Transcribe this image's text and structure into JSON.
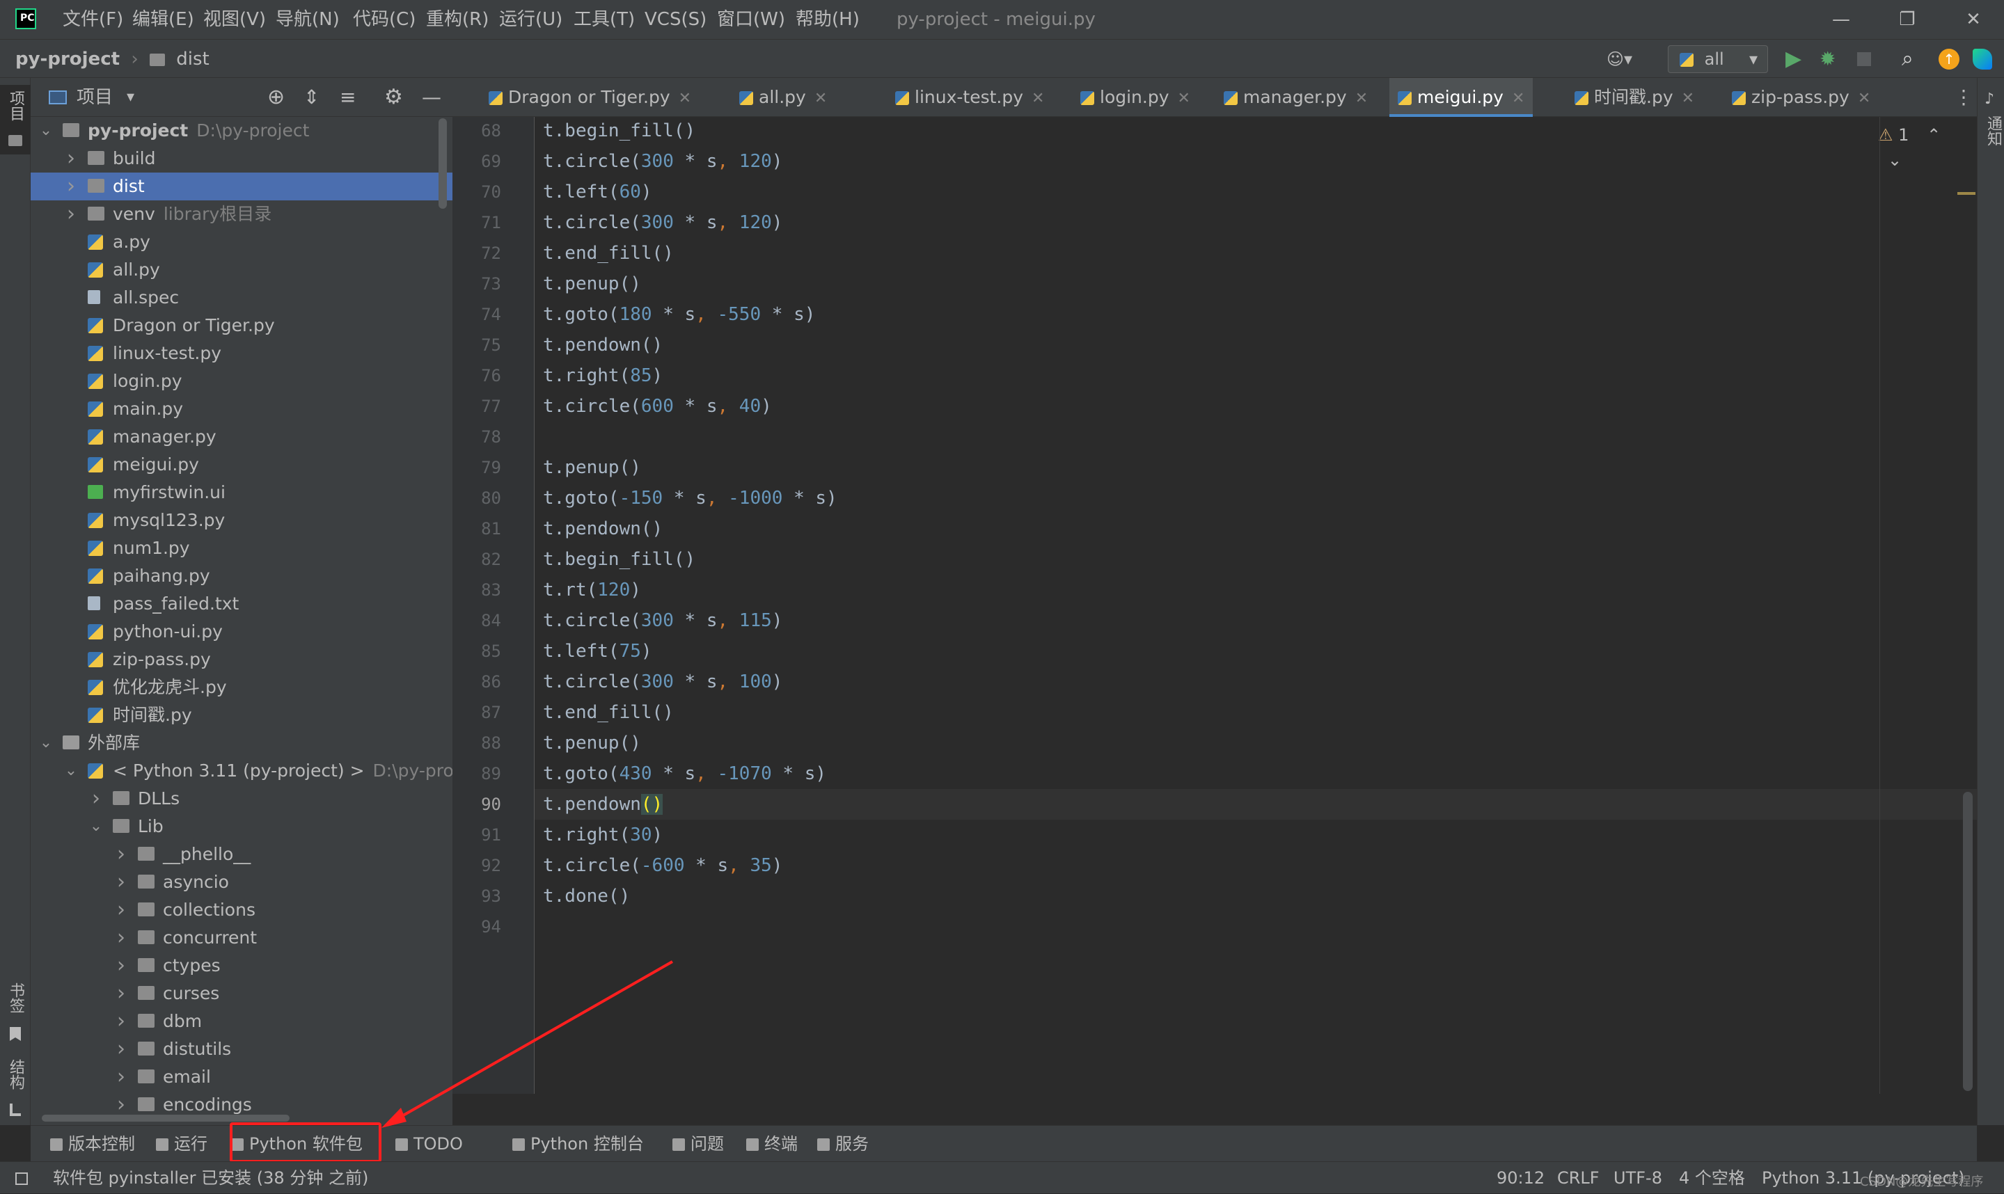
{
  "window": {
    "title": "py-project - meigui.py",
    "menus": [
      "文件(F)",
      "编辑(E)",
      "视图(V)",
      "导航(N)",
      "代码(C)",
      "重构(R)",
      "运行(U)",
      "工具(T)",
      "VCS(S)",
      "窗口(W)",
      "帮助(H)"
    ]
  },
  "navbar": {
    "project": "py-project",
    "folder": "dist",
    "run_config": "all"
  },
  "left_strip": {
    "project_label": "项目",
    "bookmarks_label": "书签",
    "structure_label": "结构"
  },
  "right_strip": {
    "notifications_label": "通知"
  },
  "project_panel": {
    "title": "项目",
    "tree": [
      {
        "label": "py-project",
        "hint": "D:\\py-project",
        "depth": 0,
        "kind": "folder",
        "expanded": true,
        "bold": true
      },
      {
        "label": "build",
        "hint": "",
        "depth": 1,
        "kind": "folder",
        "expanded": false
      },
      {
        "label": "dist",
        "hint": "",
        "depth": 1,
        "kind": "folder",
        "expanded": false,
        "selected": true
      },
      {
        "label": "venv",
        "hint": "library根目录",
        "depth": 1,
        "kind": "folder",
        "expanded": false
      },
      {
        "label": "a.py",
        "hint": "",
        "depth": 1,
        "kind": "py"
      },
      {
        "label": "all.py",
        "hint": "",
        "depth": 1,
        "kind": "py"
      },
      {
        "label": "all.spec",
        "hint": "",
        "depth": 1,
        "kind": "txt"
      },
      {
        "label": "Dragon or Tiger.py",
        "hint": "",
        "depth": 1,
        "kind": "py"
      },
      {
        "label": "linux-test.py",
        "hint": "",
        "depth": 1,
        "kind": "py"
      },
      {
        "label": "login.py",
        "hint": "",
        "depth": 1,
        "kind": "py"
      },
      {
        "label": "main.py",
        "hint": "",
        "depth": 1,
        "kind": "py"
      },
      {
        "label": "manager.py",
        "hint": "",
        "depth": 1,
        "kind": "py"
      },
      {
        "label": "meigui.py",
        "hint": "",
        "depth": 1,
        "kind": "py"
      },
      {
        "label": "myfirstwin.ui",
        "hint": "",
        "depth": 1,
        "kind": "ui"
      },
      {
        "label": "mysql123.py",
        "hint": "",
        "depth": 1,
        "kind": "py"
      },
      {
        "label": "num1.py",
        "hint": "",
        "depth": 1,
        "kind": "py"
      },
      {
        "label": "paihang.py",
        "hint": "",
        "depth": 1,
        "kind": "py"
      },
      {
        "label": "pass_failed.txt",
        "hint": "",
        "depth": 1,
        "kind": "txt"
      },
      {
        "label": "python-ui.py",
        "hint": "",
        "depth": 1,
        "kind": "py"
      },
      {
        "label": "zip-pass.py",
        "hint": "",
        "depth": 1,
        "kind": "py"
      },
      {
        "label": "优化龙虎斗.py",
        "hint": "",
        "depth": 1,
        "kind": "py"
      },
      {
        "label": "时间戳.py",
        "hint": "",
        "depth": 1,
        "kind": "py"
      },
      {
        "label": "外部库",
        "hint": "",
        "depth": 0,
        "kind": "lib",
        "expanded": true
      },
      {
        "label": "< Python 3.11 (py-project) >",
        "hint": "D:\\py-projec",
        "depth": 1,
        "kind": "python",
        "expanded": true
      },
      {
        "label": "DLLs",
        "hint": "",
        "depth": 2,
        "kind": "folder",
        "expanded": false
      },
      {
        "label": "Lib",
        "hint": "",
        "depth": 2,
        "kind": "folder",
        "expanded": true
      },
      {
        "label": "__phello__",
        "hint": "",
        "depth": 3,
        "kind": "folder",
        "expanded": false
      },
      {
        "label": "asyncio",
        "hint": "",
        "depth": 3,
        "kind": "folder",
        "expanded": false
      },
      {
        "label": "collections",
        "hint": "",
        "depth": 3,
        "kind": "folder",
        "expanded": false
      },
      {
        "label": "concurrent",
        "hint": "",
        "depth": 3,
        "kind": "folder",
        "expanded": false
      },
      {
        "label": "ctypes",
        "hint": "",
        "depth": 3,
        "kind": "folder",
        "expanded": false
      },
      {
        "label": "curses",
        "hint": "",
        "depth": 3,
        "kind": "folder",
        "expanded": false
      },
      {
        "label": "dbm",
        "hint": "",
        "depth": 3,
        "kind": "folder",
        "expanded": false
      },
      {
        "label": "distutils",
        "hint": "",
        "depth": 3,
        "kind": "folder",
        "expanded": false
      },
      {
        "label": "email",
        "hint": "",
        "depth": 3,
        "kind": "folder",
        "expanded": false
      },
      {
        "label": "encodings",
        "hint": "",
        "depth": 3,
        "kind": "folder",
        "expanded": false
      }
    ]
  },
  "tabs": [
    {
      "label": "Dragon or Tiger.py",
      "active": false
    },
    {
      "label": "all.py",
      "active": false
    },
    {
      "label": "linux-test.py",
      "active": false
    },
    {
      "label": "login.py",
      "active": false
    },
    {
      "label": "manager.py",
      "active": false
    },
    {
      "label": "meigui.py",
      "active": true
    },
    {
      "label": "时间戳.py",
      "active": false
    },
    {
      "label": "zip-pass.py",
      "active": false
    }
  ],
  "editor": {
    "warning_count": "1",
    "current_line": 90,
    "lines": [
      {
        "n": 68,
        "code": "t.begin_fill()"
      },
      {
        "n": 69,
        "code": "t.circle(300 * s, 120)"
      },
      {
        "n": 70,
        "code": "t.left(60)"
      },
      {
        "n": 71,
        "code": "t.circle(300 * s, 120)"
      },
      {
        "n": 72,
        "code": "t.end_fill()"
      },
      {
        "n": 73,
        "code": "t.penup()"
      },
      {
        "n": 74,
        "code": "t.goto(180 * s, -550 * s)"
      },
      {
        "n": 75,
        "code": "t.pendown()"
      },
      {
        "n": 76,
        "code": "t.right(85)"
      },
      {
        "n": 77,
        "code": "t.circle(600 * s, 40)"
      },
      {
        "n": 78,
        "code": ""
      },
      {
        "n": 79,
        "code": "t.penup()"
      },
      {
        "n": 80,
        "code": "t.goto(-150 * s, -1000 * s)"
      },
      {
        "n": 81,
        "code": "t.pendown()"
      },
      {
        "n": 82,
        "code": "t.begin_fill()"
      },
      {
        "n": 83,
        "code": "t.rt(120)"
      },
      {
        "n": 84,
        "code": "t.circle(300 * s, 115)"
      },
      {
        "n": 85,
        "code": "t.left(75)"
      },
      {
        "n": 86,
        "code": "t.circle(300 * s, 100)"
      },
      {
        "n": 87,
        "code": "t.end_fill()"
      },
      {
        "n": 88,
        "code": "t.penup()"
      },
      {
        "n": 89,
        "code": "t.goto(430 * s, -1070 * s)"
      },
      {
        "n": 90,
        "code": "t.pendown()"
      },
      {
        "n": 91,
        "code": "t.right(30)"
      },
      {
        "n": 92,
        "code": "t.circle(-600 * s, 35)"
      },
      {
        "n": 93,
        "code": "t.done()"
      },
      {
        "n": 94,
        "code": ""
      }
    ]
  },
  "tool_windows": [
    {
      "label": "版本控制",
      "icon": "branch-icon"
    },
    {
      "label": "运行",
      "icon": "play-icon"
    },
    {
      "label": "Python 软件包",
      "icon": "layers-icon",
      "highlighted": true
    },
    {
      "label": "TODO",
      "icon": "list-icon"
    },
    {
      "label": "Python 控制台",
      "icon": "python-icon"
    },
    {
      "label": "问题",
      "icon": "info-icon"
    },
    {
      "label": "终端",
      "icon": "terminal-icon"
    },
    {
      "label": "服务",
      "icon": "services-icon"
    }
  ],
  "statusbar": {
    "message": "软件包 pyinstaller 已安装 (38 分钟 之前)",
    "position": "90:12",
    "line_sep": "CRLF",
    "encoding": "UTF-8",
    "indent": "4 个空格",
    "interpreter": "Python 3.11 (py-project)",
    "watermark": "CSDN@龙先生写程序"
  },
  "colors": {
    "annotation": "#ff1f1f",
    "selection": "#4b6eaf",
    "run_green": "#59a869",
    "update_orange": "#f4a31b"
  }
}
